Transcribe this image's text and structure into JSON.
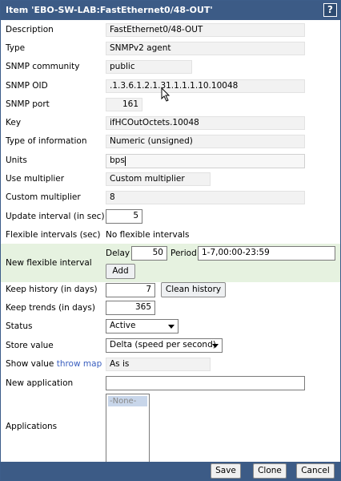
{
  "window": {
    "title": "Item 'EBO-SW-LAB:FastEthernet0/48-OUT'",
    "help": "?"
  },
  "fields": {
    "description": {
      "label": "Description",
      "value": "FastEthernet0/48-OUT"
    },
    "type": {
      "label": "Type",
      "value": "SNMPv2 agent"
    },
    "community": {
      "label": "SNMP community",
      "value": "public"
    },
    "oid": {
      "label": "SNMP OID",
      "value": ".1.3.6.1.2.1.31.1.1.1.10.10048"
    },
    "port": {
      "label": "SNMP port",
      "value": "161"
    },
    "key": {
      "label": "Key",
      "value": "ifHCOutOctets.10048"
    },
    "info_type": {
      "label": "Type of information",
      "value": "Numeric (unsigned)"
    },
    "units": {
      "label": "Units",
      "value": "bps"
    },
    "multiplier": {
      "label": "Use multiplier",
      "value": "Custom multiplier"
    },
    "custom_multiplier": {
      "label": "Custom multiplier",
      "value": "8"
    },
    "update_interval": {
      "label": "Update interval (in sec)",
      "value": "5"
    },
    "flex_intervals": {
      "label": "Flexible intervals (sec)",
      "value": "No flexible intervals"
    },
    "new_flex": {
      "label": "New flexible interval",
      "delay_label": "Delay",
      "delay_value": "50",
      "period_label": "Period",
      "period_value": "1-7,00:00-23:59",
      "add_label": "Add"
    },
    "history": {
      "label": "Keep history (in days)",
      "value": "7",
      "clean_label": "Clean history"
    },
    "trends": {
      "label": "Keep trends (in days)",
      "value": "365"
    },
    "status": {
      "label": "Status",
      "value": "Active"
    },
    "store": {
      "label": "Store value",
      "value": "Delta (speed per second)"
    },
    "show_value": {
      "label": "Show value",
      "link": "throw map",
      "value": "As is"
    },
    "new_app": {
      "label": "New application",
      "value": ""
    },
    "applications": {
      "label": "Applications",
      "options": [
        "-None-"
      ]
    }
  },
  "footer": {
    "save": "Save",
    "clone": "Clone",
    "cancel": "Cancel"
  }
}
